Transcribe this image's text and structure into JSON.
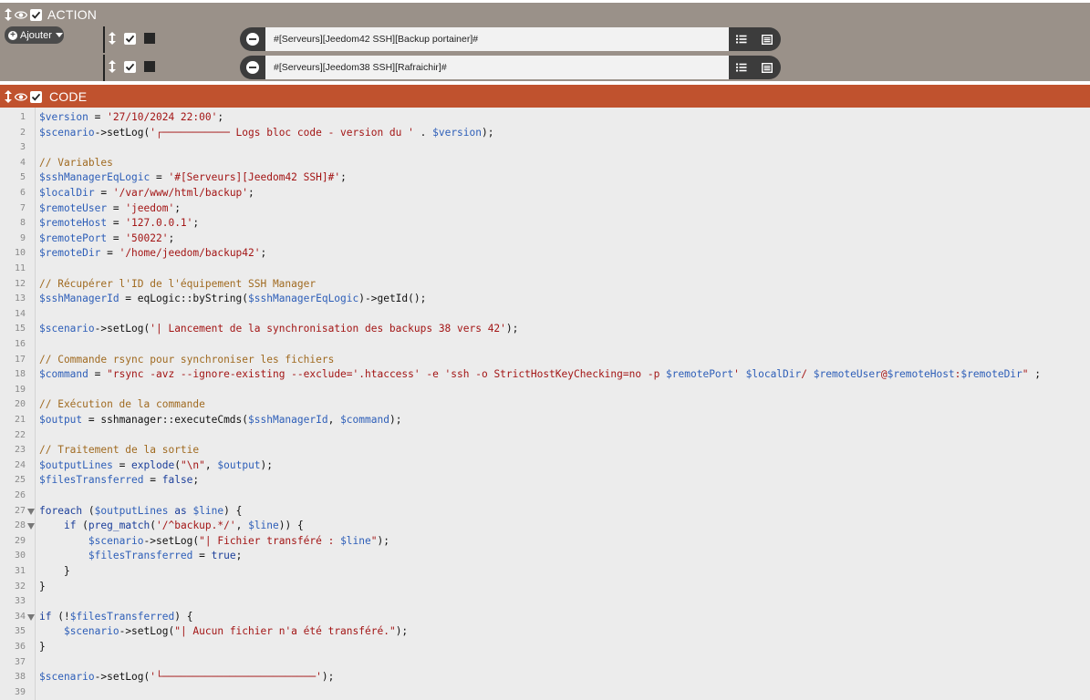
{
  "action_block": {
    "title": "ACTION",
    "add_button_label": "Ajouter",
    "commands": [
      {
        "value": "#[Serveurs][Jeedom42 SSH][Backup portainer]#"
      },
      {
        "value": "#[Serveurs][Jeedom38 SSH][Rafraichir]#"
      }
    ]
  },
  "code_block": {
    "title": "CODE",
    "lines": [
      {
        "n": "1",
        "tokens": [
          [
            "v",
            "$version"
          ],
          [
            "p",
            " = "
          ],
          [
            "s",
            "'27/10/2024 22:00'"
          ],
          [
            "p",
            ";"
          ]
        ]
      },
      {
        "n": "2",
        "tokens": [
          [
            "v",
            "$scenario"
          ],
          [
            "p",
            "->setLog("
          ],
          [
            "s",
            "'┌─────────── Logs bloc code - version du ' "
          ],
          [
            "p",
            ". "
          ],
          [
            "v",
            "$version"
          ],
          [
            "p",
            ");"
          ]
        ]
      },
      {
        "n": "3",
        "tokens": []
      },
      {
        "n": "4",
        "tokens": [
          [
            "c",
            "// Variables"
          ]
        ]
      },
      {
        "n": "5",
        "tokens": [
          [
            "v",
            "$sshManagerEqLogic"
          ],
          [
            "p",
            " = "
          ],
          [
            "s",
            "'#[Serveurs][Jeedom42 SSH]#'"
          ],
          [
            "p",
            ";"
          ]
        ]
      },
      {
        "n": "6",
        "tokens": [
          [
            "v",
            "$localDir"
          ],
          [
            "p",
            " = "
          ],
          [
            "s",
            "'/var/www/html/backup'"
          ],
          [
            "p",
            ";"
          ]
        ]
      },
      {
        "n": "7",
        "tokens": [
          [
            "v",
            "$remoteUser"
          ],
          [
            "p",
            " = "
          ],
          [
            "s",
            "'jeedom'"
          ],
          [
            "p",
            ";"
          ]
        ]
      },
      {
        "n": "8",
        "tokens": [
          [
            "v",
            "$remoteHost"
          ],
          [
            "p",
            " = "
          ],
          [
            "s",
            "'127.0.0.1'"
          ],
          [
            "p",
            ";"
          ]
        ]
      },
      {
        "n": "9",
        "tokens": [
          [
            "v",
            "$remotePort"
          ],
          [
            "p",
            " = "
          ],
          [
            "s",
            "'50022'"
          ],
          [
            "p",
            ";"
          ]
        ]
      },
      {
        "n": "10",
        "tokens": [
          [
            "v",
            "$remoteDir"
          ],
          [
            "p",
            " = "
          ],
          [
            "s",
            "'/home/jeedom/backup42'"
          ],
          [
            "p",
            ";"
          ]
        ]
      },
      {
        "n": "11",
        "tokens": []
      },
      {
        "n": "12",
        "tokens": [
          [
            "c",
            "// Récupérer l'ID de l'équipement SSH Manager"
          ]
        ]
      },
      {
        "n": "13",
        "tokens": [
          [
            "v",
            "$sshManagerId"
          ],
          [
            "p",
            " = eqLogic::byString("
          ],
          [
            "v",
            "$sshManagerEqLogic"
          ],
          [
            "p",
            ")->getId();"
          ]
        ]
      },
      {
        "n": "14",
        "tokens": []
      },
      {
        "n": "15",
        "tokens": [
          [
            "v",
            "$scenario"
          ],
          [
            "p",
            "->setLog("
          ],
          [
            "s",
            "'| Lancement de la synchronisation des backups 38 vers 42'"
          ],
          [
            "p",
            ");"
          ]
        ]
      },
      {
        "n": "16",
        "tokens": []
      },
      {
        "n": "17",
        "tokens": [
          [
            "c",
            "// Commande rsync pour synchroniser les fichiers"
          ]
        ]
      },
      {
        "n": "18",
        "tokens": [
          [
            "v",
            "$command"
          ],
          [
            "p",
            " = "
          ],
          [
            "s",
            "\"rsync -avz --ignore-existing --exclude='.htaccess' -e 'ssh -o StrictHostKeyChecking=no -p "
          ],
          [
            "v",
            "$remotePort"
          ],
          [
            "s",
            "' "
          ],
          [
            "v",
            "$localDir"
          ],
          [
            "s",
            "/ "
          ],
          [
            "v",
            "$remoteUser"
          ],
          [
            "s",
            "@"
          ],
          [
            "v",
            "$remoteHost"
          ],
          [
            "s",
            ":"
          ],
          [
            "v",
            "$remoteDir"
          ],
          [
            "s",
            "\""
          ],
          [
            "p",
            " ;"
          ]
        ]
      },
      {
        "n": "19",
        "tokens": []
      },
      {
        "n": "20",
        "tokens": [
          [
            "c",
            "// Exécution de la commande"
          ]
        ]
      },
      {
        "n": "21",
        "tokens": [
          [
            "v",
            "$output"
          ],
          [
            "p",
            " = sshmanager::executeCmds("
          ],
          [
            "v",
            "$sshManagerId"
          ],
          [
            "p",
            ", "
          ],
          [
            "v",
            "$command"
          ],
          [
            "p",
            ");"
          ]
        ]
      },
      {
        "n": "22",
        "tokens": []
      },
      {
        "n": "23",
        "tokens": [
          [
            "c",
            "// Traitement de la sortie"
          ]
        ]
      },
      {
        "n": "24",
        "tokens": [
          [
            "v",
            "$outputLines"
          ],
          [
            "p",
            " = "
          ],
          [
            "k",
            "explode"
          ],
          [
            "p",
            "("
          ],
          [
            "s",
            "\"\\n\""
          ],
          [
            "p",
            ", "
          ],
          [
            "v",
            "$output"
          ],
          [
            "p",
            ");"
          ]
        ]
      },
      {
        "n": "25",
        "tokens": [
          [
            "v",
            "$filesTransferred"
          ],
          [
            "p",
            " = "
          ],
          [
            "k",
            "false"
          ],
          [
            "p",
            ";"
          ]
        ]
      },
      {
        "n": "26",
        "tokens": []
      },
      {
        "n": "27",
        "fold": true,
        "tokens": [
          [
            "k",
            "foreach"
          ],
          [
            "p",
            " ("
          ],
          [
            "v",
            "$outputLines"
          ],
          [
            "p",
            " "
          ],
          [
            "k",
            "as"
          ],
          [
            "p",
            " "
          ],
          [
            "v",
            "$line"
          ],
          [
            "p",
            ") {"
          ]
        ]
      },
      {
        "n": "28",
        "fold": true,
        "tokens": [
          [
            "p",
            "    "
          ],
          [
            "k",
            "if"
          ],
          [
            "p",
            " ("
          ],
          [
            "k",
            "preg_match"
          ],
          [
            "p",
            "("
          ],
          [
            "s",
            "'/^backup.*/'"
          ],
          [
            "p",
            ", "
          ],
          [
            "v",
            "$line"
          ],
          [
            "p",
            ")) {"
          ]
        ]
      },
      {
        "n": "29",
        "tokens": [
          [
            "p",
            "        "
          ],
          [
            "v",
            "$scenario"
          ],
          [
            "p",
            "->setLog("
          ],
          [
            "s",
            "\"| Fichier transféré : "
          ],
          [
            "v",
            "$line"
          ],
          [
            "s",
            "\""
          ],
          [
            "p",
            ");"
          ]
        ]
      },
      {
        "n": "30",
        "tokens": [
          [
            "p",
            "        "
          ],
          [
            "v",
            "$filesTransferred"
          ],
          [
            "p",
            " = "
          ],
          [
            "k",
            "true"
          ],
          [
            "p",
            ";"
          ]
        ]
      },
      {
        "n": "31",
        "tokens": [
          [
            "p",
            "    }"
          ]
        ]
      },
      {
        "n": "32",
        "tokens": [
          [
            "p",
            "}"
          ]
        ]
      },
      {
        "n": "33",
        "tokens": []
      },
      {
        "n": "34",
        "fold": true,
        "tokens": [
          [
            "k",
            "if"
          ],
          [
            "p",
            " (!"
          ],
          [
            "v",
            "$filesTransferred"
          ],
          [
            "p",
            ") {"
          ]
        ]
      },
      {
        "n": "35",
        "tokens": [
          [
            "p",
            "    "
          ],
          [
            "v",
            "$scenario"
          ],
          [
            "p",
            "->setLog("
          ],
          [
            "s",
            "\"| Aucun fichier n'a été transféré.\""
          ],
          [
            "p",
            ");"
          ]
        ]
      },
      {
        "n": "36",
        "tokens": [
          [
            "p",
            "}"
          ]
        ]
      },
      {
        "n": "37",
        "tokens": []
      },
      {
        "n": "38",
        "tokens": [
          [
            "v",
            "$scenario"
          ],
          [
            "p",
            "->setLog("
          ],
          [
            "s",
            "'└─────────────────────────'"
          ],
          [
            "p",
            ");"
          ]
        ]
      },
      {
        "n": "39",
        "tokens": []
      }
    ]
  }
}
